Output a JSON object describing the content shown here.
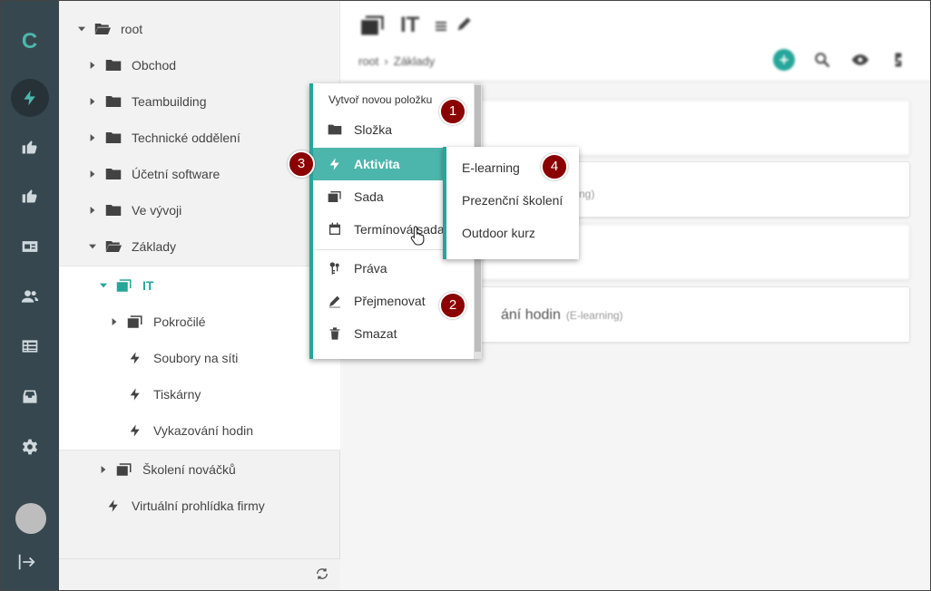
{
  "rail": {
    "logo": "C",
    "items": [
      {
        "icon": "lightning-icon"
      },
      {
        "icon": "thumbs-up-icon"
      },
      {
        "icon": "thumbs-up-icon"
      },
      {
        "icon": "id-card-icon"
      },
      {
        "icon": "users-icon"
      },
      {
        "icon": "table-icon"
      },
      {
        "icon": "inbox-icon"
      },
      {
        "icon": "gear-icon"
      }
    ]
  },
  "tree": {
    "root": "root",
    "folders": [
      "Obchod",
      "Teambuilding",
      "Technické oddělení",
      "Účetní software",
      "Ve vývoji",
      "Základy"
    ],
    "it": "IT",
    "children": [
      "Pokročilé",
      "Soubory na síti",
      "Tiskárny",
      "Vykazování hodin"
    ],
    "after": [
      "Školení nováčků",
      "Virtuální prohlídka firmy"
    ]
  },
  "header": {
    "title": "IT",
    "breadcrumb": [
      "root",
      "Základy"
    ]
  },
  "cards": {
    "last_title": "ání hodin",
    "last_tag": "(E-learning)",
    "second_tag": "ng)"
  },
  "context_menu": {
    "heading": "Vytvoř novou položku",
    "items": [
      "Složka",
      "Aktivita",
      "Sada",
      "Termínová sada",
      "Práva",
      "Přejmenovat",
      "Smazat"
    ]
  },
  "submenu": {
    "items": [
      "E-learning",
      "Prezenční školení",
      "Outdoor kurz"
    ]
  },
  "badges": [
    "1",
    "2",
    "3",
    "4"
  ],
  "colors": {
    "accent": "#26a69a",
    "rail": "#37474f",
    "badge": "#8b0000"
  }
}
